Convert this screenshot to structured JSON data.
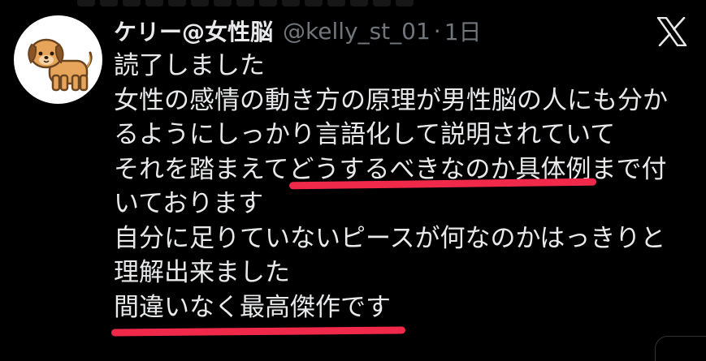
{
  "tweet": {
    "display_name": "ケリー@女性脳",
    "handle": "@kelly_st_01",
    "separator": "·",
    "time": "1日",
    "lines": [
      "読了しました",
      "女性の感情の動き方の原理が男性脳の人にも分か",
      "るようにしっかり言語化して説明されていて",
      "それを踏まえてどうするべきなのか具体例まで付",
      "いております",
      "自分に足りていないピースが何なのかはっきりと",
      "理解出来ました",
      "間違いなく最高傑作です"
    ]
  },
  "icons": {
    "avatar": "dog-avatar-icon",
    "platform": "x-logo-icon"
  },
  "colors": {
    "background": "#000000",
    "text": "#e7e9ea",
    "secondary": "#71767b",
    "highlight_underline": "#f0284a"
  }
}
